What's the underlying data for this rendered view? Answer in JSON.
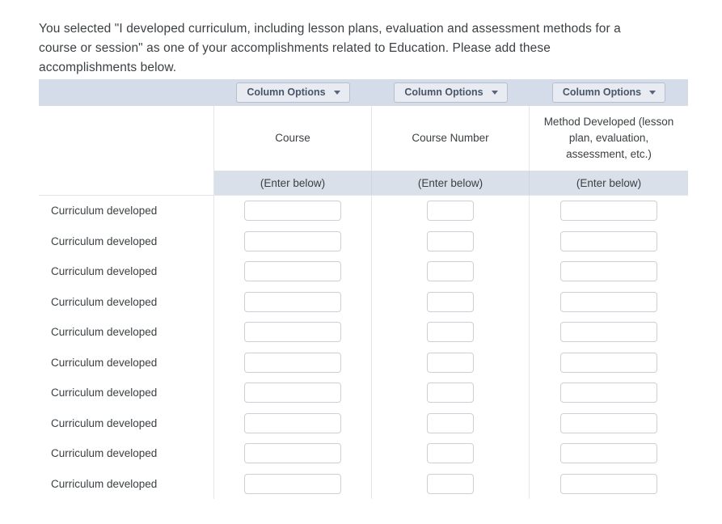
{
  "intro": {
    "text": "You selected \"I developed curriculum, including lesson plans, evaluation and assessment methods for a course or session\" as one of your accomplishments related to Education. Please add these accomplishments below."
  },
  "table": {
    "column_options_label": "Column Options",
    "caret_icon": "chevron-down-icon",
    "columns": [
      {
        "title": "Course",
        "enter_hint": "(Enter below)",
        "input_width": "wide"
      },
      {
        "title": "Course Number",
        "enter_hint": "(Enter below)",
        "input_width": "narrow"
      },
      {
        "title": "Method Developed (lesson plan, evaluation, assessment, etc.)",
        "enter_hint": "(Enter below)",
        "input_width": "wide"
      }
    ],
    "rows": [
      {
        "label": "Curriculum developed",
        "values": [
          "",
          "",
          ""
        ]
      },
      {
        "label": "Curriculum developed",
        "values": [
          "",
          "",
          ""
        ]
      },
      {
        "label": "Curriculum developed",
        "values": [
          "",
          "",
          ""
        ]
      },
      {
        "label": "Curriculum developed",
        "values": [
          "",
          "",
          ""
        ]
      },
      {
        "label": "Curriculum developed",
        "values": [
          "",
          "",
          ""
        ]
      },
      {
        "label": "Curriculum developed",
        "values": [
          "",
          "",
          ""
        ]
      },
      {
        "label": "Curriculum developed",
        "values": [
          "",
          "",
          ""
        ]
      },
      {
        "label": "Curriculum developed",
        "values": [
          "",
          "",
          ""
        ]
      },
      {
        "label": "Curriculum developed",
        "values": [
          "",
          "",
          ""
        ]
      },
      {
        "label": "Curriculum developed",
        "values": [
          "",
          "",
          ""
        ]
      }
    ],
    "colors": {
      "header_band": "#d3dce8",
      "enter_band": "#d9e0ea",
      "button_face": "#e8ecf2",
      "button_border": "#b6bfcc",
      "text": "#3c4043"
    }
  }
}
